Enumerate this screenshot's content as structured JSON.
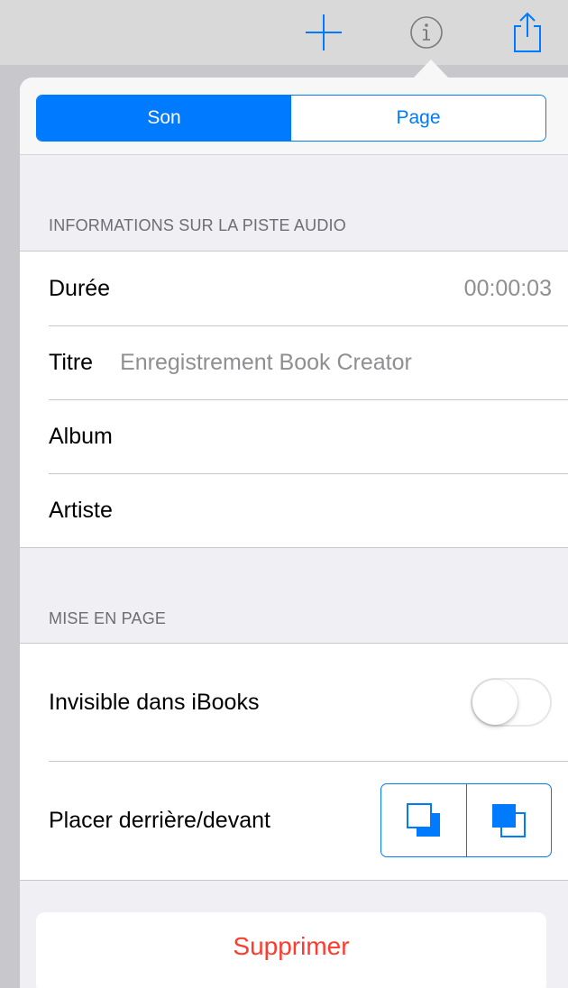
{
  "toolbar": {
    "icons": [
      "plus-icon",
      "info-icon",
      "share-icon"
    ]
  },
  "segment": {
    "options": [
      "Son",
      "Page"
    ],
    "selected": "Son"
  },
  "audio_info": {
    "header": "INFORMATIONS SUR LA PISTE AUDIO",
    "rows": [
      {
        "label": "Durée",
        "value": "00:00:03"
      },
      {
        "label": "Titre",
        "value": "Enregistrement Book Creator"
      },
      {
        "label": "Album",
        "value": ""
      },
      {
        "label": "Artiste",
        "value": ""
      }
    ]
  },
  "layout": {
    "header": "MISE EN PAGE",
    "invisible_label": "Invisible dans iBooks",
    "invisible_on": false,
    "placement_label": "Placer derrière/devant",
    "placement_icons": [
      "send-to-back-icon",
      "bring-to-front-icon"
    ]
  },
  "delete_label": "Supprimer",
  "colors": {
    "accent": "#007aff",
    "destructive": "#ff3b30",
    "secondary_text": "#8e8e93"
  }
}
